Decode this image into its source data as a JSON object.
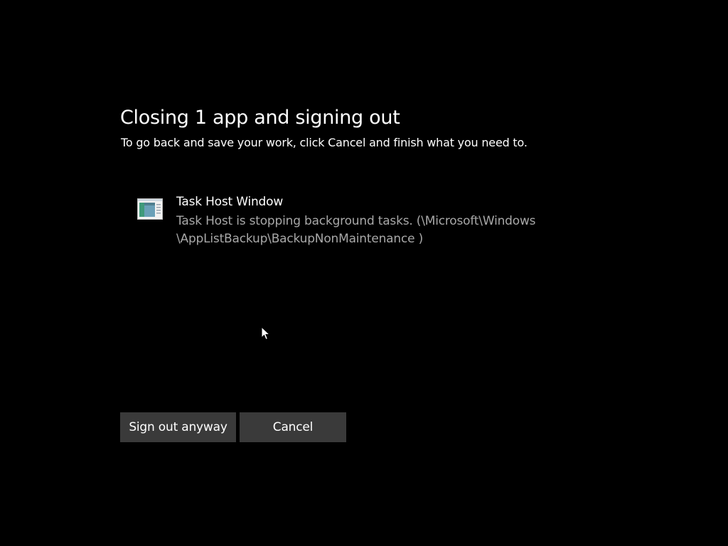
{
  "dialog": {
    "title": "Closing 1 app and signing out",
    "subtitle": "To go back and save your work, click Cancel and finish what you need to."
  },
  "apps": [
    {
      "name": "Task Host Window",
      "icon": "task-host-window-icon",
      "status_line1": "Task Host is stopping background tasks. (\\Microsoft\\Windows",
      "status_line2": "\\AppListBackup\\BackupNonMaintenance )"
    }
  ],
  "buttons": {
    "sign_out_anyway": "Sign out anyway",
    "cancel": "Cancel"
  },
  "colors": {
    "background": "#000000",
    "text_primary": "#ffffff",
    "text_secondary": "#a8a8a8",
    "button_background": "#3a3a3a"
  }
}
